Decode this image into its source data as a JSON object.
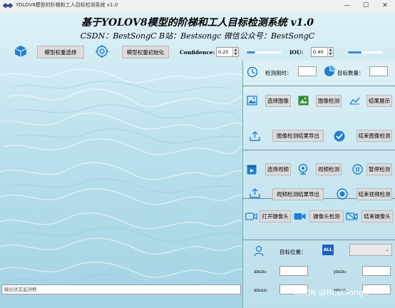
{
  "window": {
    "title": "YOLOV8模型的阶梯和工人目标检测系统 v1.0"
  },
  "header": {
    "title": "基于YOLOV8模型的阶梯和工人目标检测系统 v1.0",
    "subtitle": "CSDN：BestSongC   B站：Bestsongc   微信公众号：BestSongC"
  },
  "toolbar": {
    "model_select_label": "模型权重选择",
    "model_init_label": "模型权重初始化",
    "confidence_label": "Confidence:",
    "confidence_value": "0.25",
    "confidence_level": 0.25,
    "iou_label": "IOU:",
    "iou_value": "0.40",
    "iou_level": 0.4
  },
  "panel": {
    "time_label": "检测用时：",
    "count_label": "目标数量：",
    "select_image_label": "选择图像",
    "image_detect_label": "图像检测",
    "result_show_label": "结果展示",
    "image_export_label": "图像检测结果导出",
    "end_image_label": "结束图像检测",
    "select_video_label": "选择视频",
    "video_detect_label": "视频检测",
    "pause_detect_label": "暂停检测",
    "video_export_label": "视频检测结果导出",
    "end_video_label": "结束视频检测",
    "open_camera_label": "打开摄像头",
    "camera_detect_label": "摄像头检测",
    "close_camera_label": "结束摄像头",
    "target_position_label": "目标位置：",
    "all_badge": "ALL",
    "xmin_label": "xmin:",
    "ymin_label": "ymin:",
    "xmax_label": "xmax:",
    "ymax_label": "ymax:"
  },
  "status": {
    "output_placeholder": "输出状态监测框"
  },
  "watermark": "CSDN @BestSongC",
  "colors": {
    "accent": "#3b8fd6",
    "water": "#b8e0ec"
  }
}
